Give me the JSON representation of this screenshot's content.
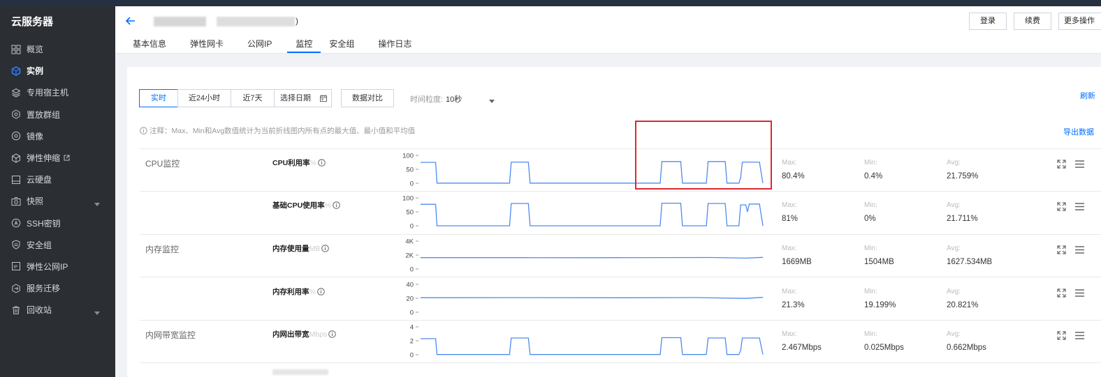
{
  "sidebar": {
    "title": "云服务器",
    "items": [
      {
        "label": "概览",
        "icon": "grid-icon"
      },
      {
        "label": "实例",
        "icon": "cube-icon",
        "active": true
      },
      {
        "label": "专用宿主机",
        "icon": "layers-icon"
      },
      {
        "label": "置放群组",
        "icon": "hexagon-icon"
      },
      {
        "label": "镜像",
        "icon": "disc-icon"
      },
      {
        "label": "弹性伸缩",
        "icon": "scale-icon",
        "external": true
      },
      {
        "label": "云硬盘",
        "icon": "disk-icon"
      },
      {
        "label": "快照",
        "icon": "camera-icon",
        "expandable": true
      },
      {
        "label": "SSH密钥",
        "icon": "key-icon"
      },
      {
        "label": "安全组",
        "icon": "shield-icon"
      },
      {
        "label": "弹性公网IP",
        "icon": "ip-icon"
      },
      {
        "label": "服务迁移",
        "icon": "migrate-icon"
      },
      {
        "label": "回收站",
        "icon": "trash-icon",
        "expandable": true
      }
    ]
  },
  "header": {
    "paren": ")",
    "tabs": [
      "基本信息",
      "弹性网卡",
      "公网IP",
      "监控",
      "安全组",
      "操作日志"
    ],
    "active_tab": 3,
    "buttons": {
      "login": "登录",
      "renew": "续费",
      "more": "更多操作"
    }
  },
  "toolbar": {
    "realtime": "实时",
    "last24h": "近24小时",
    "last7d": "近7天",
    "pick_date": "选择日期",
    "compare": "数据对比",
    "granularity_label": "时间粒度:",
    "granularity_value": "10秒",
    "refresh": "刷新",
    "note": "注释：Max、Min和Avg数值统计为当前折线图内所有点的最大值、最小值和平均值",
    "export": "导出数据"
  },
  "stat_labels": {
    "max": "Max:",
    "min": "Min:",
    "avg": "Avg:"
  },
  "groups": {
    "cpu": "CPU监控",
    "mem": "内存监控",
    "net": "内网带宽监控"
  },
  "metrics": [
    {
      "name": "CPU利用率",
      "unit": "%",
      "ticks": [
        "100",
        "50",
        "0"
      ],
      "max": "80.4%",
      "min": "0.4%",
      "avg": "21.759%"
    },
    {
      "name": "基础CPU使用率",
      "unit": "%",
      "ticks": [
        "100",
        "50",
        "0"
      ],
      "max": "81%",
      "min": "0%",
      "avg": "21.711%"
    },
    {
      "name": "内存使用量",
      "unit": "MB",
      "ticks": [
        "4K",
        "2K",
        "0"
      ],
      "max": "1669MB",
      "min": "1504MB",
      "avg": "1627.534MB"
    },
    {
      "name": "内存利用率",
      "unit": "%",
      "ticks": [
        "40",
        "20",
        "0"
      ],
      "max": "21.3%",
      "min": "19.199%",
      "avg": "20.821%"
    },
    {
      "name": "内网出带宽",
      "unit": "Mbps",
      "ticks": [
        "4",
        "2",
        "0"
      ],
      "max": "2.467Mbps",
      "min": "0.025Mbps",
      "avg": "0.662Mbps"
    }
  ],
  "chart_data": [
    {
      "type": "line",
      "title": "CPU利用率",
      "ylim": [
        0,
        100
      ],
      "points": [
        [
          0,
          75
        ],
        [
          0.044,
          75
        ],
        [
          0.048,
          0.4
        ],
        [
          0.26,
          0.4
        ],
        [
          0.265,
          76
        ],
        [
          0.315,
          76
        ],
        [
          0.32,
          0.4
        ],
        [
          0.7,
          0.4
        ],
        [
          0.705,
          78
        ],
        [
          0.76,
          78
        ],
        [
          0.765,
          0.4
        ],
        [
          0.835,
          0.4
        ],
        [
          0.84,
          78
        ],
        [
          0.89,
          78
        ],
        [
          0.895,
          0.4
        ],
        [
          0.93,
          0.4
        ],
        [
          0.935,
          20
        ],
        [
          0.94,
          76
        ],
        [
          0.99,
          76
        ],
        [
          1.0,
          0.4
        ]
      ]
    },
    {
      "type": "line",
      "title": "基础CPU使用率",
      "ylim": [
        0,
        100
      ],
      "points": [
        [
          0,
          77
        ],
        [
          0.044,
          77
        ],
        [
          0.048,
          0
        ],
        [
          0.26,
          0
        ],
        [
          0.265,
          80
        ],
        [
          0.315,
          80
        ],
        [
          0.32,
          0
        ],
        [
          0.7,
          0
        ],
        [
          0.705,
          81
        ],
        [
          0.76,
          81
        ],
        [
          0.765,
          0
        ],
        [
          0.835,
          0
        ],
        [
          0.84,
          80
        ],
        [
          0.89,
          80
        ],
        [
          0.895,
          0
        ],
        [
          0.93,
          0
        ],
        [
          0.935,
          75
        ],
        [
          0.95,
          75
        ],
        [
          0.955,
          50
        ],
        [
          0.96,
          78
        ],
        [
          0.99,
          78
        ],
        [
          1.0,
          0
        ]
      ]
    },
    {
      "type": "line",
      "title": "内存使用量",
      "ylim": [
        0,
        4000
      ],
      "points": [
        [
          0,
          1627
        ],
        [
          0.3,
          1630
        ],
        [
          0.5,
          1620
        ],
        [
          0.7,
          1640
        ],
        [
          0.85,
          1650
        ],
        [
          0.95,
          1560
        ],
        [
          1.0,
          1669
        ]
      ]
    },
    {
      "type": "line",
      "title": "内存利用率",
      "ylim": [
        0,
        40
      ],
      "points": [
        [
          0,
          20.8
        ],
        [
          0.3,
          20.9
        ],
        [
          0.6,
          20.7
        ],
        [
          0.8,
          21.0
        ],
        [
          0.95,
          19.8
        ],
        [
          1.0,
          21.3
        ]
      ]
    },
    {
      "type": "line",
      "title": "内网出带宽",
      "ylim": [
        0,
        4
      ],
      "points": [
        [
          0,
          2.3
        ],
        [
          0.044,
          2.3
        ],
        [
          0.048,
          0.03
        ],
        [
          0.26,
          0.03
        ],
        [
          0.265,
          2.4
        ],
        [
          0.315,
          2.4
        ],
        [
          0.32,
          0.03
        ],
        [
          0.7,
          0.03
        ],
        [
          0.705,
          2.45
        ],
        [
          0.76,
          2.45
        ],
        [
          0.765,
          0.03
        ],
        [
          0.835,
          0.03
        ],
        [
          0.84,
          2.4
        ],
        [
          0.89,
          2.4
        ],
        [
          0.895,
          0.03
        ],
        [
          0.93,
          0.03
        ],
        [
          0.935,
          0.6
        ],
        [
          0.94,
          2.4
        ],
        [
          0.99,
          2.4
        ],
        [
          1.0,
          0.03
        ]
      ]
    }
  ],
  "colors": {
    "accent": "#006eff",
    "line": "#4d8bf0",
    "highlight": "#e0262e",
    "sidebar": "#2b2e33"
  }
}
